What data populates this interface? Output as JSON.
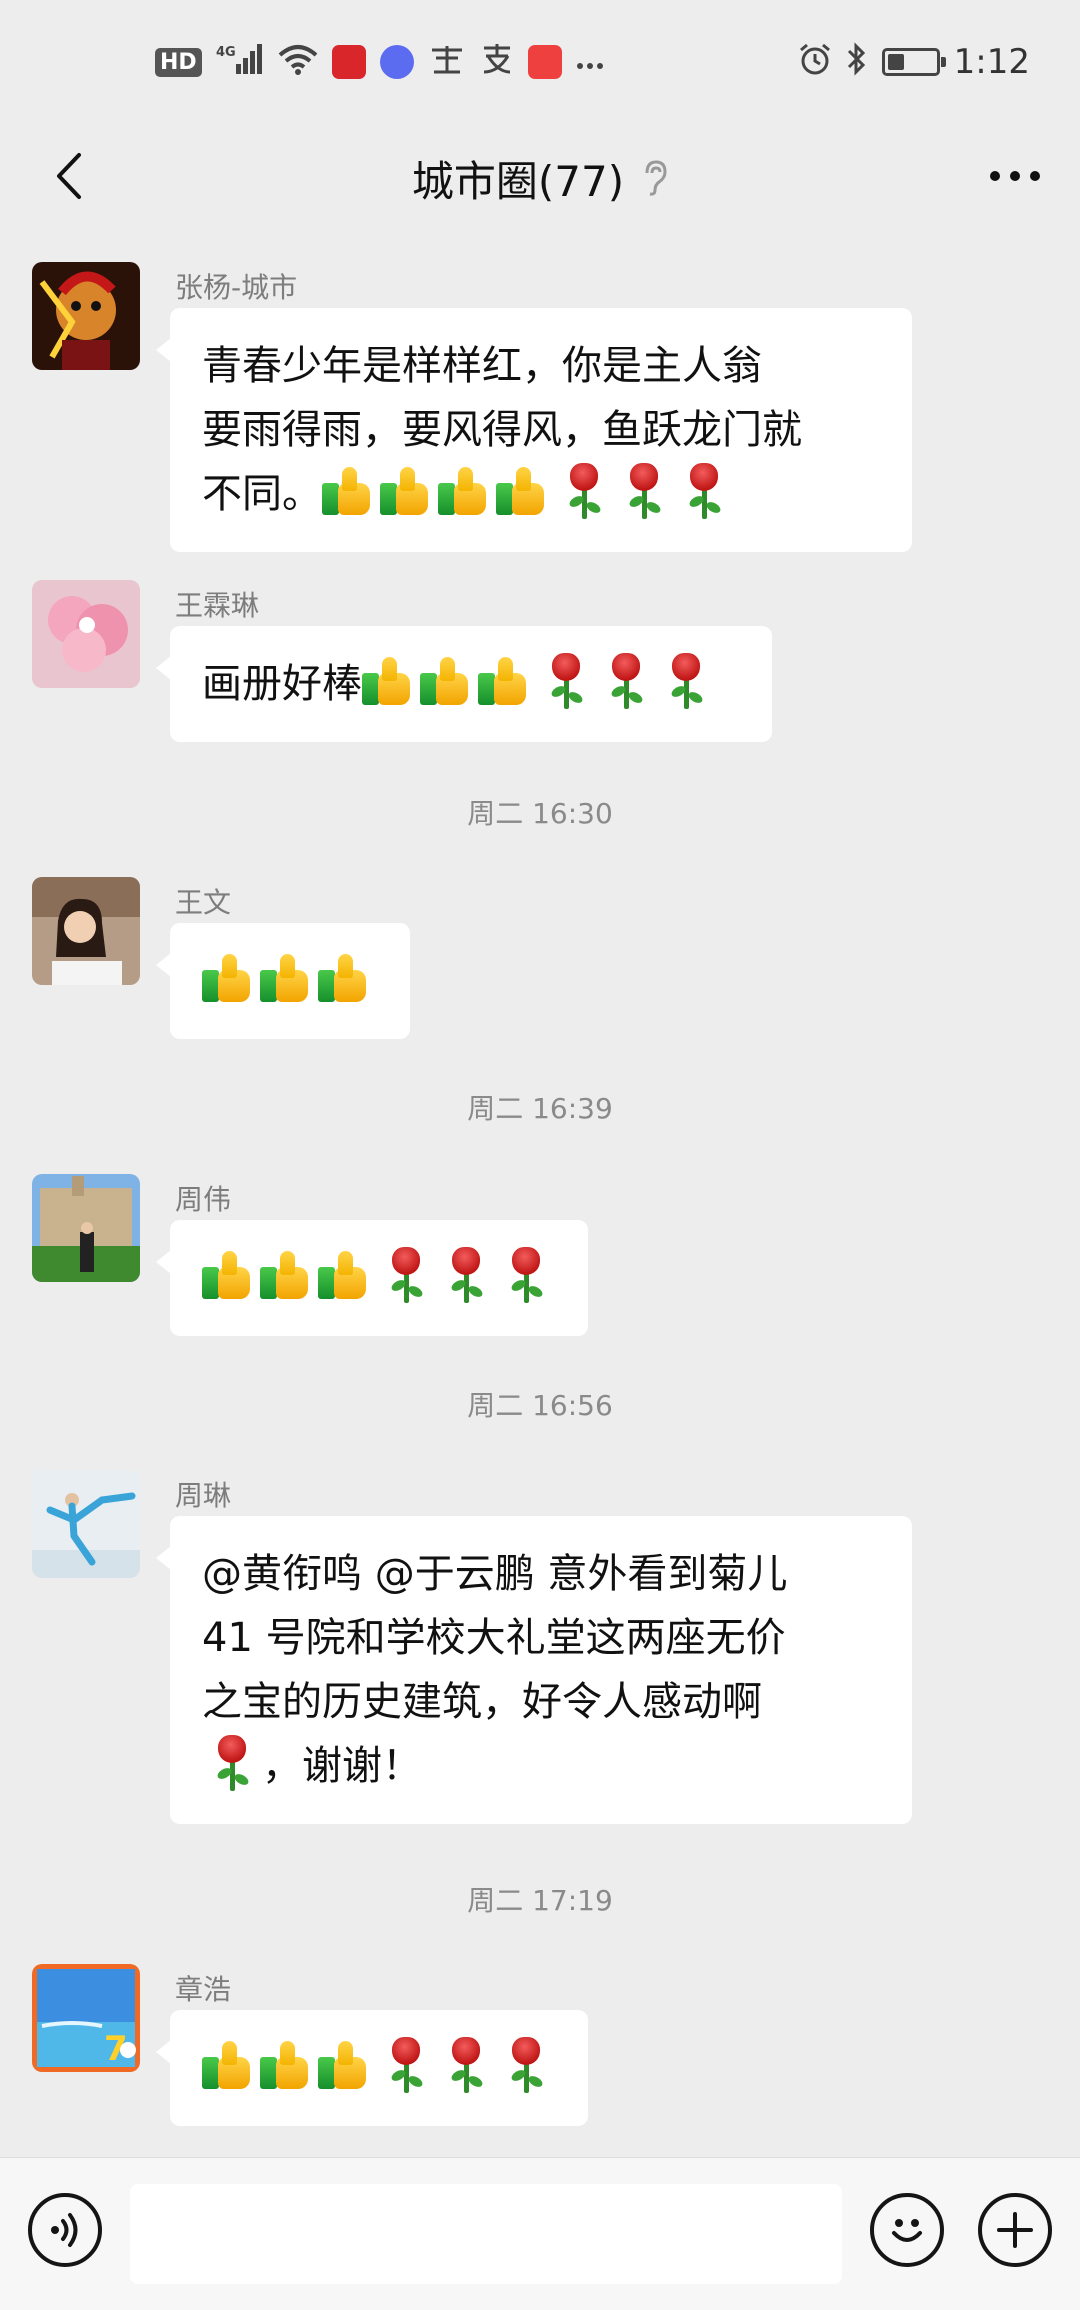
{
  "status_bar": {
    "hd": "HD",
    "network": "4G",
    "time": "1:12",
    "battery_level": 0.35,
    "icons": [
      "hd-badge",
      "signal-icon",
      "wifi-icon",
      "app-red-icon",
      "music-icon",
      "study-app-icon",
      "alipay-icon",
      "huawei-icon",
      "more-icon",
      "alarm-icon",
      "bluetooth-icon",
      "battery-icon"
    ]
  },
  "nav": {
    "title": "城市圈(77)",
    "back_icon": "chevron-left-icon",
    "mute_icon": "ear-icon",
    "more_icon": "more-dots-icon"
  },
  "messages": [
    {
      "sender": "张杨-城市",
      "avatar": "avatar-zhangyang",
      "lines": [
        "青春少年是样样红，你是主人翁",
        "要雨得雨，要风得风，鱼跃龙门就",
        "不同。"
      ],
      "thumbs": 4,
      "roses": 3
    },
    {
      "sender": "王霖琳",
      "avatar": "avatar-wanglinlin",
      "lines": [
        "画册好棒"
      ],
      "thumbs": 3,
      "roses": 3
    },
    {
      "sender": "王文",
      "avatar": "avatar-wangwen",
      "lines": [],
      "thumbs": 3,
      "roses": 0
    },
    {
      "sender": "周伟",
      "avatar": "avatar-zhouwei",
      "lines": [],
      "thumbs": 3,
      "roses": 3
    },
    {
      "sender": "周琳",
      "avatar": "avatar-zhoulin",
      "lines": [
        "@黄衔鸣  @于云鹏  意外看到菊儿",
        "41 号院和学校大礼堂这两座无价",
        "之宝的历史建筑，好令人感动啊",
        "，谢谢！"
      ],
      "thumbs": 0,
      "roses": 1
    },
    {
      "sender": "章浩",
      "avatar": "avatar-zhanghao",
      "lines": [],
      "thumbs": 3,
      "roses": 3
    }
  ],
  "timestamps": [
    "周二 16:30",
    "周二 16:39",
    "周二 16:56",
    "周二 17:19"
  ],
  "input_bar": {
    "placeholder": "",
    "voice_icon": "voice-icon",
    "emoji_icon": "emoji-icon",
    "plus_icon": "plus-icon"
  }
}
